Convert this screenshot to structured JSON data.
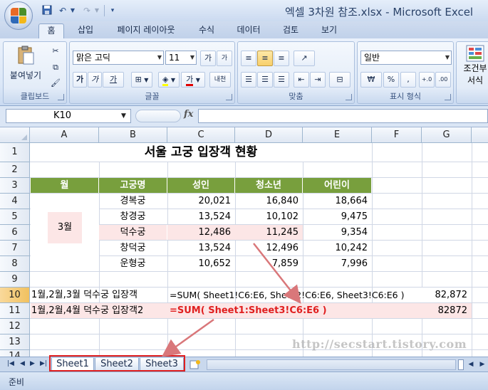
{
  "title": "엑셀 3차원 참조.xlsx - Microsoft Excel",
  "ribbon_tabs": [
    "홈",
    "삽입",
    "페이지 레이아웃",
    "수식",
    "데이터",
    "검토",
    "보기"
  ],
  "ribbon": {
    "clipboard": {
      "paste": "붙여넣기",
      "label": "클립보드"
    },
    "font": {
      "name": "맑은 고딕",
      "size": "11",
      "bold": "가",
      "italic": "가",
      "underline": "가",
      "grow": "가",
      "shrink": "가",
      "color": "가",
      "phonetic": "내천",
      "label": "글꼴"
    },
    "alignment": {
      "label": "맞춤"
    },
    "number": {
      "format": "일반",
      "currency": "₩",
      "percent": "%",
      "comma": ",",
      "inc": "+.0",
      "dec": ".00",
      "label": "표시 형식"
    },
    "styles": {
      "cond1": "조건부",
      "cond2": "서식"
    }
  },
  "formula_bar": {
    "name_box": "K10",
    "fx": "fx",
    "value": ""
  },
  "columns": [
    "A",
    "B",
    "C",
    "D",
    "E",
    "F",
    "G"
  ],
  "rows": [
    "1",
    "2",
    "3",
    "4",
    "5",
    "6",
    "7",
    "8",
    "9",
    "10",
    "11",
    "12",
    "13",
    "14"
  ],
  "sheet": {
    "title": "서울 고궁 입장객 현황",
    "headers": [
      "월",
      "고궁명",
      "성인",
      "청소년",
      "어린이"
    ],
    "month": "3월",
    "data": [
      [
        "경복궁",
        "20,021",
        "16,840",
        "18,664"
      ],
      [
        "창경궁",
        "13,524",
        "10,102",
        "9,475"
      ],
      [
        "덕수궁",
        "12,486",
        "11,245",
        "9,354"
      ],
      [
        "창덕궁",
        "13,524",
        "12,496",
        "10,242"
      ],
      [
        "운형궁",
        "10,652",
        "7,859",
        "7,996"
      ]
    ],
    "row10": {
      "label": "1월,2월,3월 덕수궁 입장객",
      "formula": "=SUM( Sheet1!C6:E6, Sheet2!C6:E6, Sheet3!C6:E6 )",
      "result": "82,872"
    },
    "row11": {
      "label": "1월,2월,4월 덕수궁 입장객2",
      "formula": "=SUM( Sheet1:Sheet3!C6:E6 )",
      "result": "82872"
    }
  },
  "sheet_tabs": [
    "Sheet1",
    "Sheet2",
    "Sheet3"
  ],
  "status": "준비",
  "watermark": "http://secstart.tistory.com",
  "colors": {
    "header_green": "#789f3d",
    "highlight_pink": "#fce6e6",
    "formula_red": "#e02020",
    "arrow": "#d9777a"
  }
}
